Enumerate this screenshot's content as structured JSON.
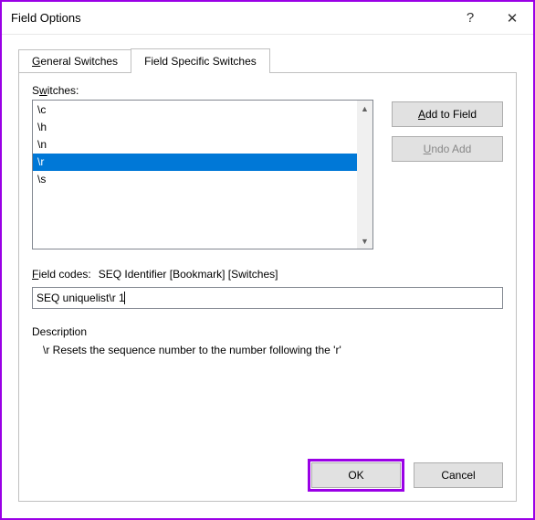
{
  "titlebar": {
    "title": "Field Options",
    "help": "?",
    "close": "✕"
  },
  "tabs": {
    "general": "General Switches",
    "specific": "Field Specific Switches"
  },
  "switches": {
    "label": "Switches:",
    "items": [
      "\\c",
      "\\h",
      "\\n",
      "\\r",
      "\\s"
    ],
    "selected_index": 3
  },
  "buttons": {
    "add": "Add to Field",
    "undo": "Undo Add",
    "ok": "OK",
    "cancel": "Cancel"
  },
  "field_codes": {
    "label": "Field codes:",
    "hint": "SEQ Identifier [Bookmark] [Switches]",
    "value": "SEQ uniquelist\\r 1"
  },
  "description": {
    "label": "Description",
    "text": "\\r Resets the sequence number to the number following the 'r'"
  }
}
